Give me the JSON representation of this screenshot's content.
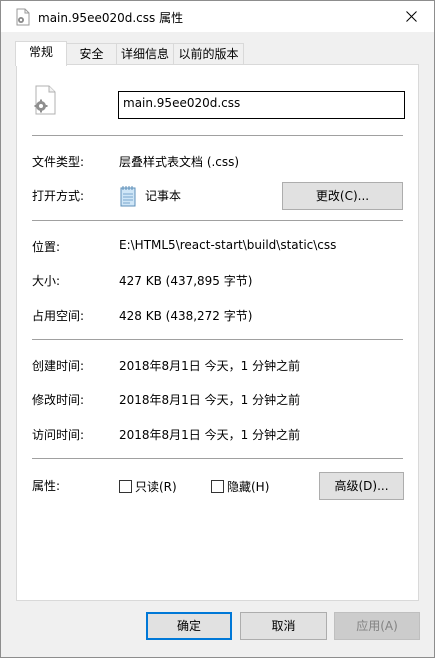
{
  "window": {
    "title": "main.95ee020d.css 属性"
  },
  "tabs": [
    {
      "label": "常规",
      "active": true
    },
    {
      "label": "安全",
      "active": false
    },
    {
      "label": "详细信息",
      "active": false
    },
    {
      "label": "以前的版本",
      "active": false
    }
  ],
  "general": {
    "filename": "main.95ee020d.css",
    "file_type_label": "文件类型:",
    "file_type_value": "层叠样式表文档 (.css)",
    "open_with_label": "打开方式:",
    "open_with_value": "记事本",
    "change_button": "更改(C)...",
    "location_label": "位置:",
    "location_value": "E:\\HTML5\\react-start\\build\\static\\css",
    "size_label": "大小:",
    "size_value": "427 KB (437,895 字节)",
    "size_on_disk_label": "占用空间:",
    "size_on_disk_value": "428 KB (438,272 字节)",
    "created_label": "创建时间:",
    "created_value": "2018年8月1日 今天，1 分钟之前",
    "modified_label": "修改时间:",
    "modified_value": "2018年8月1日 今天，1 分钟之前",
    "accessed_label": "访问时间:",
    "accessed_value": "2018年8月1日 今天，1 分钟之前",
    "attributes_label": "属性:",
    "readonly_label": "只读(R)",
    "readonly_checked": false,
    "hidden_label": "隐藏(H)",
    "hidden_checked": false,
    "advanced_button": "高级(D)..."
  },
  "footer": {
    "ok": "确定",
    "cancel": "取消",
    "apply": "应用(A)"
  },
  "colors": {
    "accent": "#0078d7",
    "desktop": "#a8677f"
  },
  "icons": [
    "css-file-icon",
    "close-icon",
    "gear-file-icon",
    "notepad-icon",
    "checkbox"
  ]
}
